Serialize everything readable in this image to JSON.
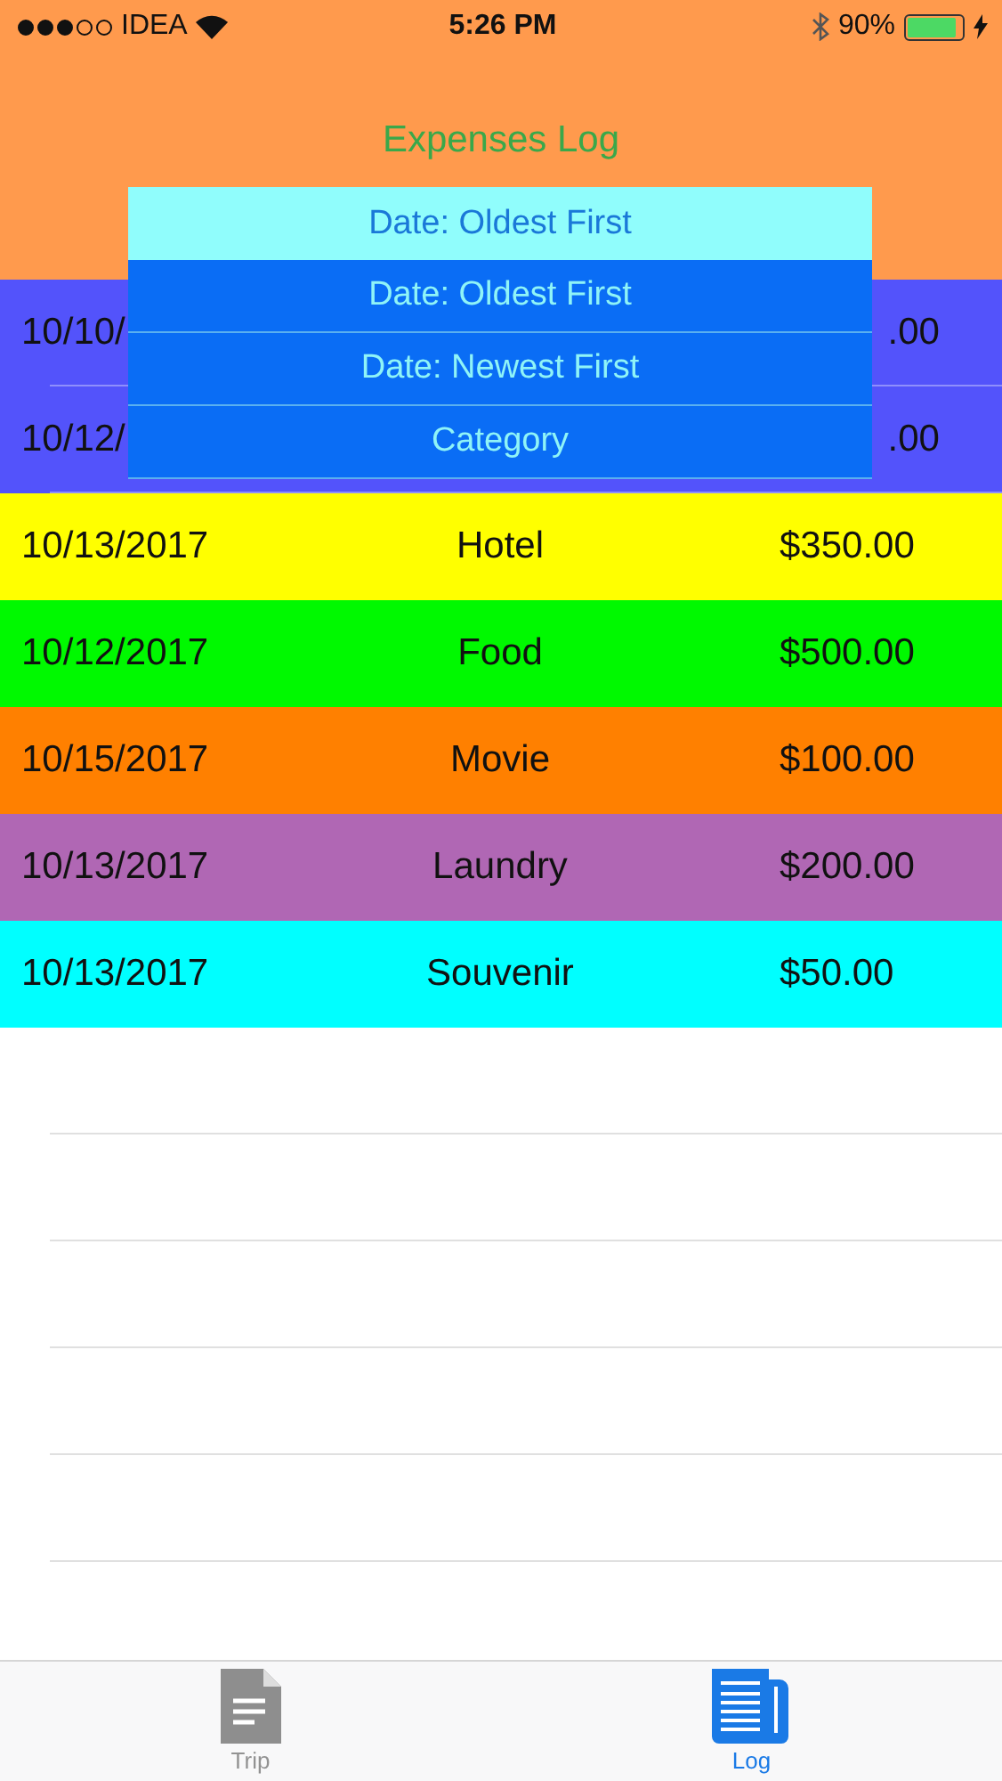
{
  "status_bar": {
    "carrier": "IDEA",
    "time": "5:26 PM",
    "battery": "90%"
  },
  "header": {
    "title": "Expenses Log"
  },
  "sort_menu": {
    "current": "Date: Oldest First",
    "options": [
      "Date: Oldest First",
      "Date: Newest First",
      "Category"
    ]
  },
  "expenses": [
    {
      "kind": "covered",
      "date": "10/10/",
      "amount": ".00",
      "color": "#5353fb"
    },
    {
      "kind": "covered",
      "date": "10/12/",
      "amount": ".00",
      "color": "#5353fb"
    },
    {
      "date": "10/13/2017",
      "category": "Hotel",
      "amount": "$350.00",
      "color": "#ffff00"
    },
    {
      "date": "10/12/2017",
      "category": "Food",
      "amount": "$500.00",
      "color": "#00f900"
    },
    {
      "date": "10/15/2017",
      "category": "Movie",
      "amount": "$100.00",
      "color": "#ff8000"
    },
    {
      "date": "10/13/2017",
      "category": "Laundry",
      "amount": "$200.00",
      "color": "#b067b4"
    },
    {
      "date": "10/13/2017",
      "category": "Souvenir",
      "amount": "$50.00",
      "color": "#00ffff"
    }
  ],
  "tab_bar": [
    {
      "label": "Trip",
      "kind": "document",
      "selected": false
    },
    {
      "label": "Log",
      "kind": "newspaper",
      "selected": true
    }
  ]
}
